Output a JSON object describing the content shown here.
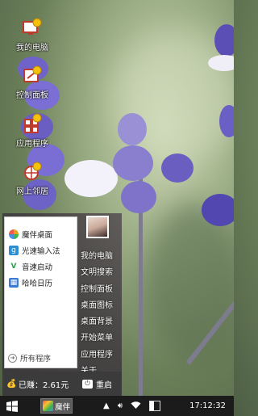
{
  "desktop": {
    "icons": [
      {
        "label": "我的电脑",
        "icon": "my-computer-icon"
      },
      {
        "label": "控制面板",
        "icon": "control-panel-icon"
      },
      {
        "label": "应用程序",
        "icon": "applications-icon"
      },
      {
        "label": "网上邻居",
        "icon": "network-icon"
      }
    ]
  },
  "start_menu": {
    "pinned": [
      {
        "label": "魔伴桌面",
        "icon": "pinwheel-icon",
        "color": "#e8a21a"
      },
      {
        "label": "光速输入法",
        "icon": "keyboard-g-icon",
        "color": "#2d8fd4"
      },
      {
        "label": "音速启动",
        "icon": "v-launcher-icon",
        "color": "#2aa44a"
      },
      {
        "label": "哈哈日历",
        "icon": "calendar-icon",
        "color": "#3a7bd5"
      }
    ],
    "all_programs": "所有程序",
    "right_links": [
      "我的电脑",
      "文明搜索",
      "控制面板",
      "桌面图标",
      "桌面背景",
      "开始菜单",
      "应用程序",
      "关于..."
    ],
    "earned": "已赚：2.61元",
    "restart": "重启"
  },
  "taskbar": {
    "app_label": "魔伴",
    "clock": "17:12:32"
  }
}
